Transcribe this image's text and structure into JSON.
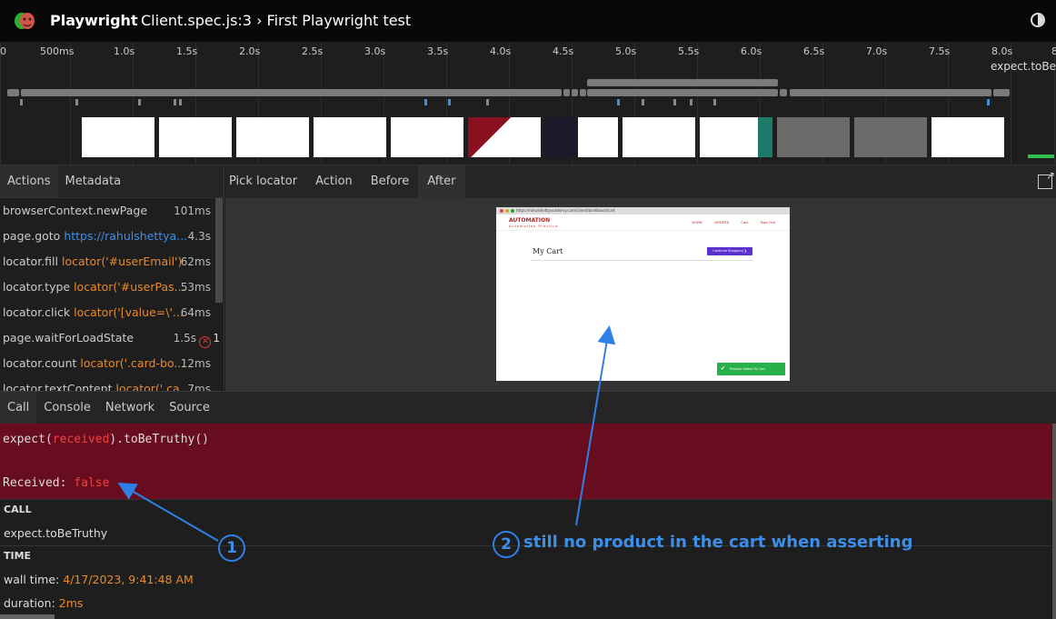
{
  "header": {
    "app_name": "Playwright",
    "title": "Client.spec.js:3 › First Playwright test"
  },
  "timeline": {
    "ticks": [
      "0",
      "500ms",
      "1.0s",
      "1.5s",
      "2.0s",
      "2.5s",
      "3.0s",
      "3.5s",
      "4.0s",
      "4.5s",
      "5.0s",
      "5.5s",
      "6.0s",
      "6.5s",
      "7.0s",
      "7.5s",
      "8.0s",
      "8"
    ],
    "hover_label": "expect.toBe"
  },
  "actions_panel": {
    "tabs": [
      "Actions",
      "Metadata"
    ],
    "rows": [
      {
        "name": "browserContext.newPage",
        "arg": "",
        "time": "101ms"
      },
      {
        "name": "page.goto",
        "arg": "https://rahulshettya...",
        "time": "4.3s"
      },
      {
        "name": "locator.fill",
        "arg": "locator('#userEmail')",
        "time": "62ms"
      },
      {
        "name": "locator.type",
        "arg": "locator('#userPas...",
        "time": "53ms"
      },
      {
        "name": "locator.click",
        "arg": "locator('[value=\\'...",
        "time": "64ms"
      },
      {
        "name": "page.waitForLoadState",
        "arg": "",
        "time": "1.5s",
        "errors": "1"
      },
      {
        "name": "locator.count",
        "arg": "locator('.card-bo...",
        "time": "12ms"
      },
      {
        "name": "locator.textContent",
        "arg": "locator('.ca...",
        "time": "7ms"
      }
    ]
  },
  "snapshot_panel": {
    "tabs": [
      "Pick locator",
      "Action",
      "Before",
      "After"
    ],
    "snapshot": {
      "url": "https://rahulshettyacademy.com/client/dashboard/cart",
      "brand": "AUTOMATION",
      "brand_sub": "Automation Practice",
      "nav_links": [
        "HOME",
        "ORDERS",
        "Cart",
        "Sign Out"
      ],
      "cart_title": "My Cart",
      "continue_button": "Continue Shopping ❯",
      "toast": "Product Added To Cart"
    }
  },
  "bottom": {
    "tabs": [
      "Call",
      "Console",
      "Network",
      "Source"
    ],
    "error": {
      "prefix": "expect(",
      "received_word": "received",
      "suffix": ").toBeTruthy()",
      "received_label": "Received: ",
      "received_value": "false"
    },
    "call_heading": "CALL",
    "call_value": "expect.toBeTruthy",
    "time_heading": "TIME",
    "wall_time_label": "wall time:",
    "wall_time_value": "4/17/2023, 9:41:48 AM",
    "duration_label": "duration:",
    "duration_value": "2ms"
  },
  "annotations": {
    "badge1": "1",
    "badge2": "2",
    "note": "still no product in the cart when asserting"
  },
  "colors": {
    "accent_blue": "#3d8ee8",
    "error_bg": "#680c20",
    "locator_orange": "#e88a2a",
    "error_red": "#f53f3f"
  }
}
